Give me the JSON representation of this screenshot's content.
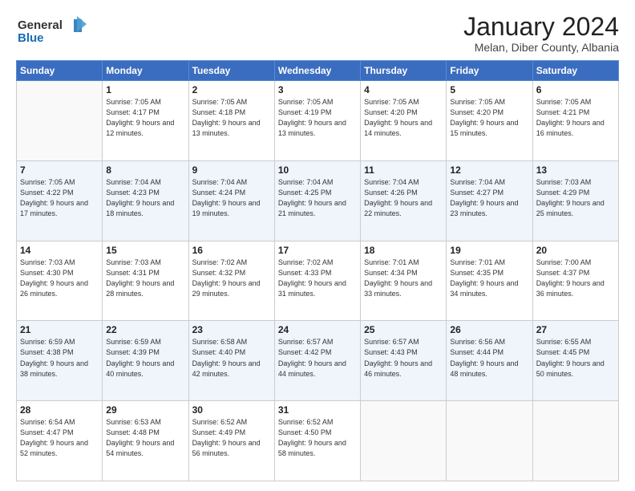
{
  "logo": {
    "line1": "General",
    "line2": "Blue"
  },
  "title": "January 2024",
  "subtitle": "Melan, Diber County, Albania",
  "weekdays": [
    "Sunday",
    "Monday",
    "Tuesday",
    "Wednesday",
    "Thursday",
    "Friday",
    "Saturday"
  ],
  "weeks": [
    [
      {
        "day": "",
        "sunrise": "",
        "sunset": "",
        "daylight": ""
      },
      {
        "day": "1",
        "sunrise": "Sunrise: 7:05 AM",
        "sunset": "Sunset: 4:17 PM",
        "daylight": "Daylight: 9 hours and 12 minutes."
      },
      {
        "day": "2",
        "sunrise": "Sunrise: 7:05 AM",
        "sunset": "Sunset: 4:18 PM",
        "daylight": "Daylight: 9 hours and 13 minutes."
      },
      {
        "day": "3",
        "sunrise": "Sunrise: 7:05 AM",
        "sunset": "Sunset: 4:19 PM",
        "daylight": "Daylight: 9 hours and 13 minutes."
      },
      {
        "day": "4",
        "sunrise": "Sunrise: 7:05 AM",
        "sunset": "Sunset: 4:20 PM",
        "daylight": "Daylight: 9 hours and 14 minutes."
      },
      {
        "day": "5",
        "sunrise": "Sunrise: 7:05 AM",
        "sunset": "Sunset: 4:20 PM",
        "daylight": "Daylight: 9 hours and 15 minutes."
      },
      {
        "day": "6",
        "sunrise": "Sunrise: 7:05 AM",
        "sunset": "Sunset: 4:21 PM",
        "daylight": "Daylight: 9 hours and 16 minutes."
      }
    ],
    [
      {
        "day": "7",
        "sunrise": "Sunrise: 7:05 AM",
        "sunset": "Sunset: 4:22 PM",
        "daylight": "Daylight: 9 hours and 17 minutes."
      },
      {
        "day": "8",
        "sunrise": "Sunrise: 7:04 AM",
        "sunset": "Sunset: 4:23 PM",
        "daylight": "Daylight: 9 hours and 18 minutes."
      },
      {
        "day": "9",
        "sunrise": "Sunrise: 7:04 AM",
        "sunset": "Sunset: 4:24 PM",
        "daylight": "Daylight: 9 hours and 19 minutes."
      },
      {
        "day": "10",
        "sunrise": "Sunrise: 7:04 AM",
        "sunset": "Sunset: 4:25 PM",
        "daylight": "Daylight: 9 hours and 21 minutes."
      },
      {
        "day": "11",
        "sunrise": "Sunrise: 7:04 AM",
        "sunset": "Sunset: 4:26 PM",
        "daylight": "Daylight: 9 hours and 22 minutes."
      },
      {
        "day": "12",
        "sunrise": "Sunrise: 7:04 AM",
        "sunset": "Sunset: 4:27 PM",
        "daylight": "Daylight: 9 hours and 23 minutes."
      },
      {
        "day": "13",
        "sunrise": "Sunrise: 7:03 AM",
        "sunset": "Sunset: 4:29 PM",
        "daylight": "Daylight: 9 hours and 25 minutes."
      }
    ],
    [
      {
        "day": "14",
        "sunrise": "Sunrise: 7:03 AM",
        "sunset": "Sunset: 4:30 PM",
        "daylight": "Daylight: 9 hours and 26 minutes."
      },
      {
        "day": "15",
        "sunrise": "Sunrise: 7:03 AM",
        "sunset": "Sunset: 4:31 PM",
        "daylight": "Daylight: 9 hours and 28 minutes."
      },
      {
        "day": "16",
        "sunrise": "Sunrise: 7:02 AM",
        "sunset": "Sunset: 4:32 PM",
        "daylight": "Daylight: 9 hours and 29 minutes."
      },
      {
        "day": "17",
        "sunrise": "Sunrise: 7:02 AM",
        "sunset": "Sunset: 4:33 PM",
        "daylight": "Daylight: 9 hours and 31 minutes."
      },
      {
        "day": "18",
        "sunrise": "Sunrise: 7:01 AM",
        "sunset": "Sunset: 4:34 PM",
        "daylight": "Daylight: 9 hours and 33 minutes."
      },
      {
        "day": "19",
        "sunrise": "Sunrise: 7:01 AM",
        "sunset": "Sunset: 4:35 PM",
        "daylight": "Daylight: 9 hours and 34 minutes."
      },
      {
        "day": "20",
        "sunrise": "Sunrise: 7:00 AM",
        "sunset": "Sunset: 4:37 PM",
        "daylight": "Daylight: 9 hours and 36 minutes."
      }
    ],
    [
      {
        "day": "21",
        "sunrise": "Sunrise: 6:59 AM",
        "sunset": "Sunset: 4:38 PM",
        "daylight": "Daylight: 9 hours and 38 minutes."
      },
      {
        "day": "22",
        "sunrise": "Sunrise: 6:59 AM",
        "sunset": "Sunset: 4:39 PM",
        "daylight": "Daylight: 9 hours and 40 minutes."
      },
      {
        "day": "23",
        "sunrise": "Sunrise: 6:58 AM",
        "sunset": "Sunset: 4:40 PM",
        "daylight": "Daylight: 9 hours and 42 minutes."
      },
      {
        "day": "24",
        "sunrise": "Sunrise: 6:57 AM",
        "sunset": "Sunset: 4:42 PM",
        "daylight": "Daylight: 9 hours and 44 minutes."
      },
      {
        "day": "25",
        "sunrise": "Sunrise: 6:57 AM",
        "sunset": "Sunset: 4:43 PM",
        "daylight": "Daylight: 9 hours and 46 minutes."
      },
      {
        "day": "26",
        "sunrise": "Sunrise: 6:56 AM",
        "sunset": "Sunset: 4:44 PM",
        "daylight": "Daylight: 9 hours and 48 minutes."
      },
      {
        "day": "27",
        "sunrise": "Sunrise: 6:55 AM",
        "sunset": "Sunset: 4:45 PM",
        "daylight": "Daylight: 9 hours and 50 minutes."
      }
    ],
    [
      {
        "day": "28",
        "sunrise": "Sunrise: 6:54 AM",
        "sunset": "Sunset: 4:47 PM",
        "daylight": "Daylight: 9 hours and 52 minutes."
      },
      {
        "day": "29",
        "sunrise": "Sunrise: 6:53 AM",
        "sunset": "Sunset: 4:48 PM",
        "daylight": "Daylight: 9 hours and 54 minutes."
      },
      {
        "day": "30",
        "sunrise": "Sunrise: 6:52 AM",
        "sunset": "Sunset: 4:49 PM",
        "daylight": "Daylight: 9 hours and 56 minutes."
      },
      {
        "day": "31",
        "sunrise": "Sunrise: 6:52 AM",
        "sunset": "Sunset: 4:50 PM",
        "daylight": "Daylight: 9 hours and 58 minutes."
      },
      {
        "day": "",
        "sunrise": "",
        "sunset": "",
        "daylight": ""
      },
      {
        "day": "",
        "sunrise": "",
        "sunset": "",
        "daylight": ""
      },
      {
        "day": "",
        "sunrise": "",
        "sunset": "",
        "daylight": ""
      }
    ]
  ]
}
